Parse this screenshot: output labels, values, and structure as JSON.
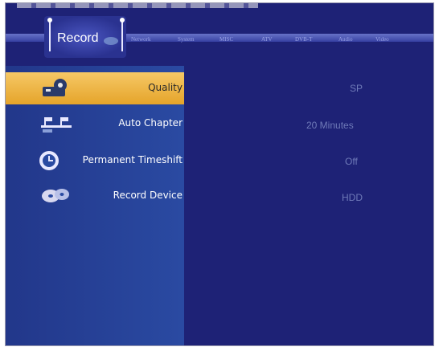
{
  "tabs": [
    {
      "label": "Network"
    },
    {
      "label": "System"
    },
    {
      "label": "MISC"
    },
    {
      "label": "ATV"
    },
    {
      "label": "DVB-T"
    },
    {
      "label": "Audio"
    },
    {
      "label": "Video"
    }
  ],
  "active_tab": {
    "label": "Record"
  },
  "menu": [
    {
      "label": "Quality",
      "value": "SP",
      "icon": "film-reel-icon",
      "selected": true
    },
    {
      "label": "Auto Chapter",
      "value": "20 Minutes",
      "icon": "chapter-flags-icon",
      "selected": false
    },
    {
      "label": "Permanent Timeshift",
      "value": "Off",
      "icon": "clock-timeshift-icon",
      "selected": false
    },
    {
      "label": "Record Device",
      "value": "HDD",
      "icon": "disc-device-icon",
      "selected": false
    }
  ],
  "colors": {
    "background": "#1e2276",
    "highlight": "#f0b84a",
    "panel": "#2a4aa2"
  }
}
